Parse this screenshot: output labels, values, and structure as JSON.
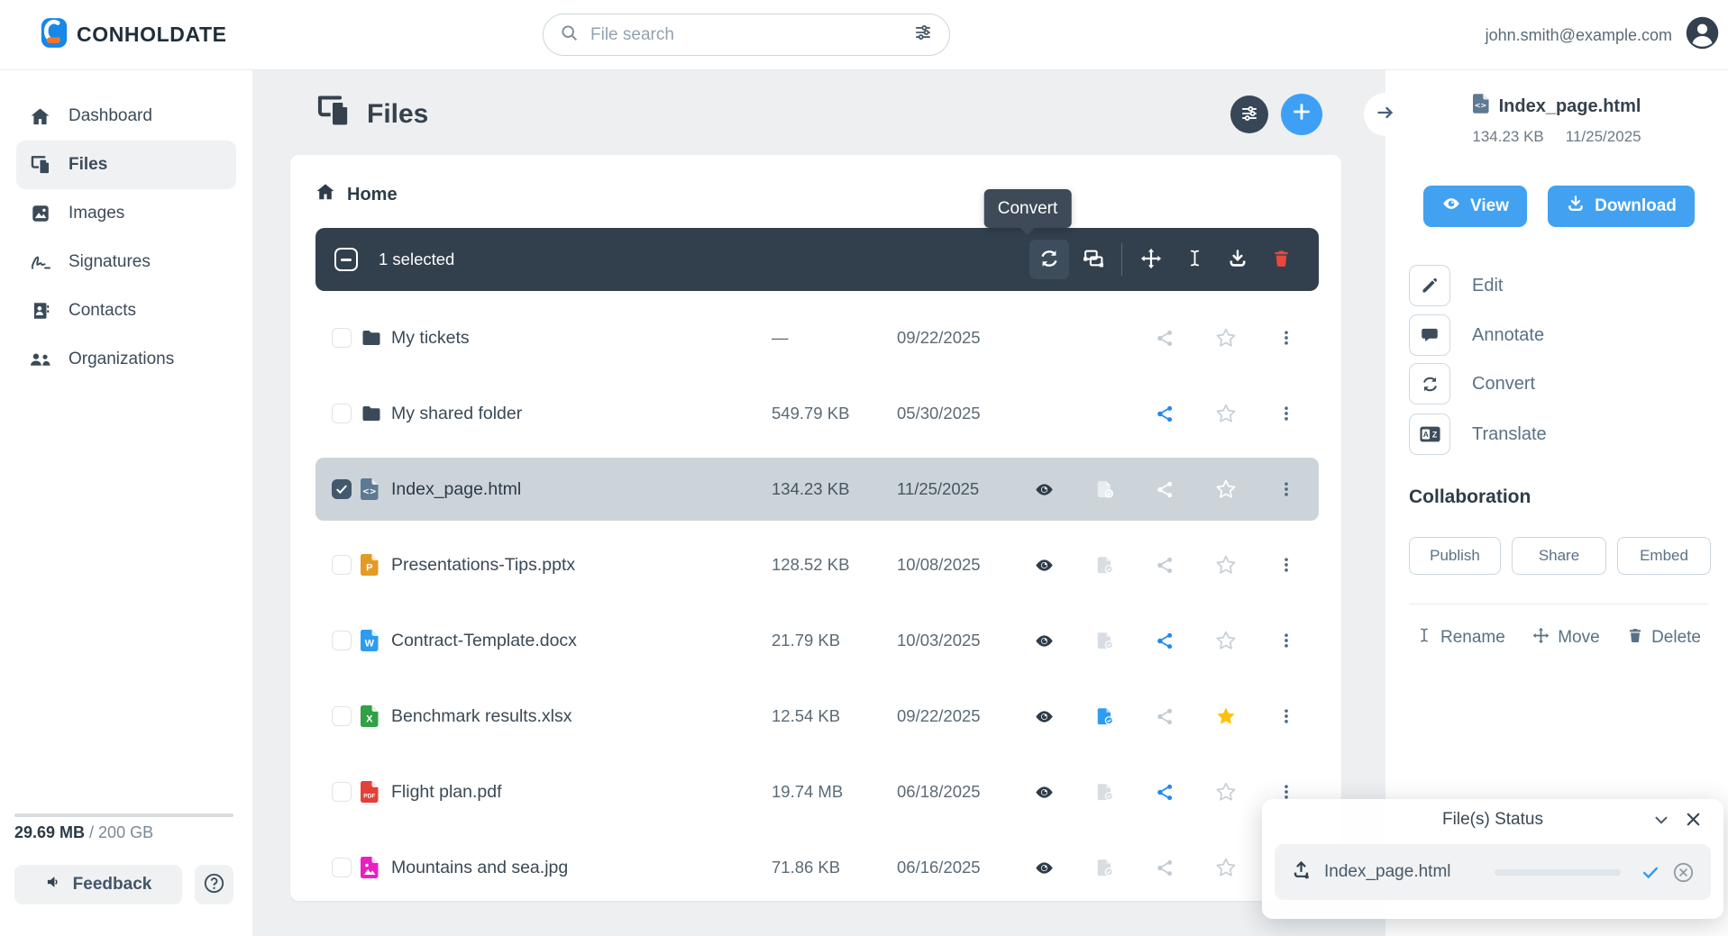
{
  "header": {
    "brand": "CONHOLDATE",
    "search_placeholder": "File search",
    "user_email": "john.smith@example.com"
  },
  "sidebar": {
    "items": [
      {
        "label": "Dashboard",
        "icon": "home-icon",
        "active": false
      },
      {
        "label": "Files",
        "icon": "files-icon",
        "active": true
      },
      {
        "label": "Images",
        "icon": "image-icon",
        "active": false
      },
      {
        "label": "Signatures",
        "icon": "signature-icon",
        "active": false
      },
      {
        "label": "Contacts",
        "icon": "contacts-icon",
        "active": false
      },
      {
        "label": "Organizations",
        "icon": "people-icon",
        "active": false
      }
    ],
    "storage_used": "29.69 MB",
    "storage_total": " / 200 GB",
    "feedback_label": "Feedback"
  },
  "main": {
    "title": "Files",
    "breadcrumb": "Home",
    "toolbar": {
      "selected_text": "1 selected",
      "tooltip": "Convert",
      "icons": [
        "select-all-checkbox",
        "convert-icon",
        "combine-icon",
        "move-icon",
        "rename-icon",
        "download-icon",
        "delete-icon"
      ]
    },
    "rows": [
      {
        "name": "My tickets",
        "type": "folder",
        "size": "—",
        "date": "09/22/2025",
        "selected": false,
        "checked": false,
        "eye": false,
        "filecheck": null,
        "share": "gray",
        "star": "gray"
      },
      {
        "name": "My shared folder",
        "type": "folder",
        "size": "549.79 KB",
        "date": "05/30/2025",
        "selected": false,
        "checked": false,
        "eye": false,
        "filecheck": null,
        "share": "blue",
        "star": "gray"
      },
      {
        "name": "Index_page.html",
        "type": "html",
        "size": "134.23 KB",
        "date": "11/25/2025",
        "selected": true,
        "checked": true,
        "eye": true,
        "filecheck": "light",
        "share": "white",
        "star": "white"
      },
      {
        "name": "Presentations-Tips.pptx",
        "type": "pptx",
        "size": "128.52 KB",
        "date": "10/08/2025",
        "selected": false,
        "checked": false,
        "eye": true,
        "filecheck": "gray",
        "share": "gray",
        "star": "gray"
      },
      {
        "name": "Contract-Template.docx",
        "type": "docx",
        "size": "21.79 KB",
        "date": "10/03/2025",
        "selected": false,
        "checked": false,
        "eye": true,
        "filecheck": "gray",
        "share": "blue",
        "star": "gray"
      },
      {
        "name": "Benchmark results.xlsx",
        "type": "xlsx",
        "size": "12.54 KB",
        "date": "09/22/2025",
        "selected": false,
        "checked": false,
        "eye": true,
        "filecheck": "blue",
        "share": "gray",
        "star": "yellow"
      },
      {
        "name": "Flight plan.pdf",
        "type": "pdf",
        "size": "19.74 MB",
        "date": "06/18/2025",
        "selected": false,
        "checked": false,
        "eye": true,
        "filecheck": "gray",
        "share": "blue",
        "star": "gray"
      },
      {
        "name": "Mountains and sea.jpg",
        "type": "jpg",
        "size": "71.86 KB",
        "date": "06/16/2025",
        "selected": false,
        "checked": false,
        "eye": true,
        "filecheck": "gray",
        "share": "gray",
        "star": "gray"
      }
    ]
  },
  "details_panel": {
    "file_name": "Index_page.html",
    "file_size": "134.23 KB",
    "file_date": "11/25/2025",
    "view_label": "View",
    "download_label": "Download",
    "actions": [
      {
        "label": "Edit",
        "icon": "pencil-icon"
      },
      {
        "label": "Annotate",
        "icon": "comment-icon"
      },
      {
        "label": "Convert",
        "icon": "convert-icon"
      },
      {
        "label": "Translate",
        "icon": "translate-icon"
      }
    ],
    "collaboration_heading": "Collaboration",
    "publish_label": "Publish",
    "share_label": "Share",
    "embed_label": "Embed",
    "rename_label": "Rename",
    "move_label": "Move",
    "delete_label": "Delete"
  },
  "status_panel": {
    "title": "File(s) Status",
    "file_name": "Index_page.html",
    "progress_percent": 100
  },
  "colors": {
    "accent_blue": "#42a1f1",
    "share_blue": "#2287ef",
    "progress_blue": "#2d9cf3",
    "star_yellow": "#fdc10d",
    "danger_red": "#e8483e",
    "dark_slate": "#33414e",
    "toolbar_bg": "#323f4c",
    "selected_row_bg": "#ccd4da",
    "folder": "#3a4a59",
    "html": "#5d7994",
    "pptx": "#e39b26",
    "docx": "#2b9cf2",
    "xlsx": "#31a046",
    "pdf": "#e4403a",
    "jpg": "#e91fc3"
  }
}
